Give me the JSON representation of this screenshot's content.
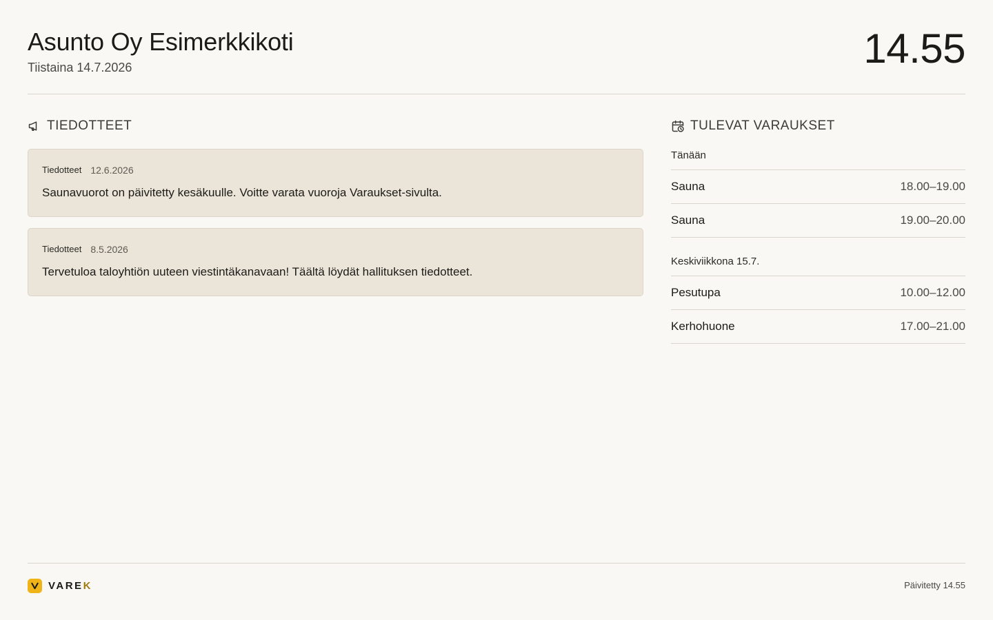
{
  "header": {
    "title": "Asunto Oy Esimerkkikoti",
    "date": "Tiistaina 14.7.2026",
    "clock": "14.55"
  },
  "notices": {
    "heading": "TIEDOTTEET",
    "icon": "megaphone-icon",
    "items": [
      {
        "category": "Tiedotteet",
        "date": "12.6.2026",
        "text": "Saunavuorot on päivitetty kesäkuulle. Voitte varata vuoroja Varaukset-sivulta."
      },
      {
        "category": "Tiedotteet",
        "date": "8.5.2026",
        "text": "Tervetuloa taloyhtiön uuteen viestintäkanavaan! Täältä löydät hallituksen tiedotteet."
      }
    ]
  },
  "reservations": {
    "heading": "TULEVAT VARAUKSET",
    "icon": "calendar-clock-icon",
    "days": [
      {
        "label": "Tänään",
        "items": [
          {
            "name": "Sauna",
            "time": "18.00–19.00"
          },
          {
            "name": "Sauna",
            "time": "19.00–20.00"
          }
        ]
      },
      {
        "label": "Keskiviikkona 15.7.",
        "items": [
          {
            "name": "Pesutupa",
            "time": "10.00–12.00"
          },
          {
            "name": "Kerhohuone",
            "time": "17.00–21.00"
          }
        ]
      }
    ]
  },
  "footer": {
    "brand_main": "VARE",
    "brand_accent": "K",
    "brand_color": "#f0b419",
    "updated": "Päivitetty 14.55"
  }
}
